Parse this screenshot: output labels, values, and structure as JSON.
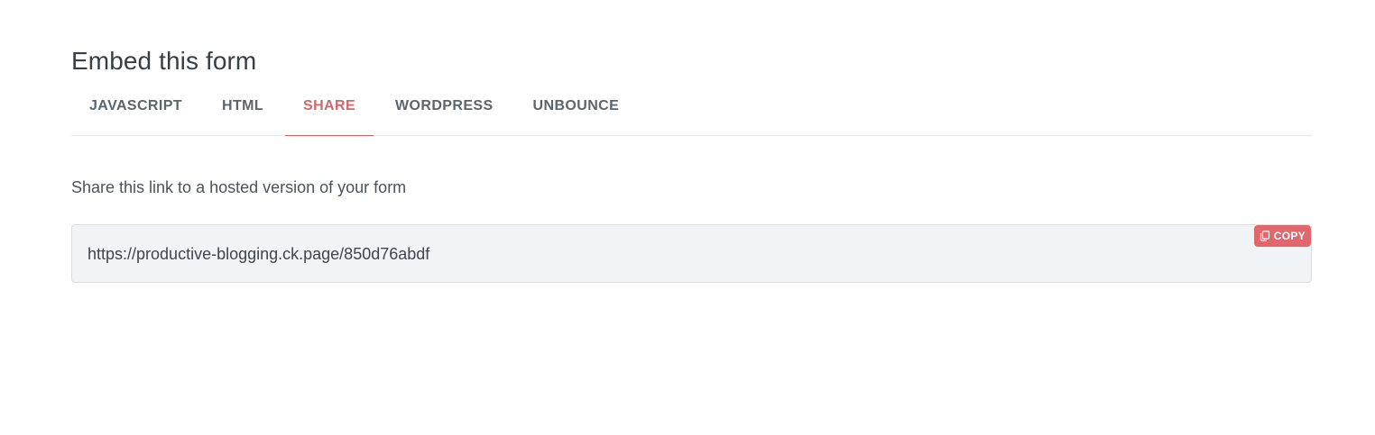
{
  "page": {
    "title": "Embed this form"
  },
  "tabs": [
    {
      "label": "JAVASCRIPT",
      "active": false
    },
    {
      "label": "HTML",
      "active": false
    },
    {
      "label": "SHARE",
      "active": true
    },
    {
      "label": "WORDPRESS",
      "active": false
    },
    {
      "label": "UNBOUNCE",
      "active": false
    }
  ],
  "share": {
    "description": "Share this link to a hosted version of your form",
    "url": "https://productive-blogging.ck.page/850d76abdf",
    "copy_label": "COPY",
    "copy_icon": "copy-icon"
  },
  "colors": {
    "accent": "#e0676b",
    "active_tab": "#d0676b"
  }
}
